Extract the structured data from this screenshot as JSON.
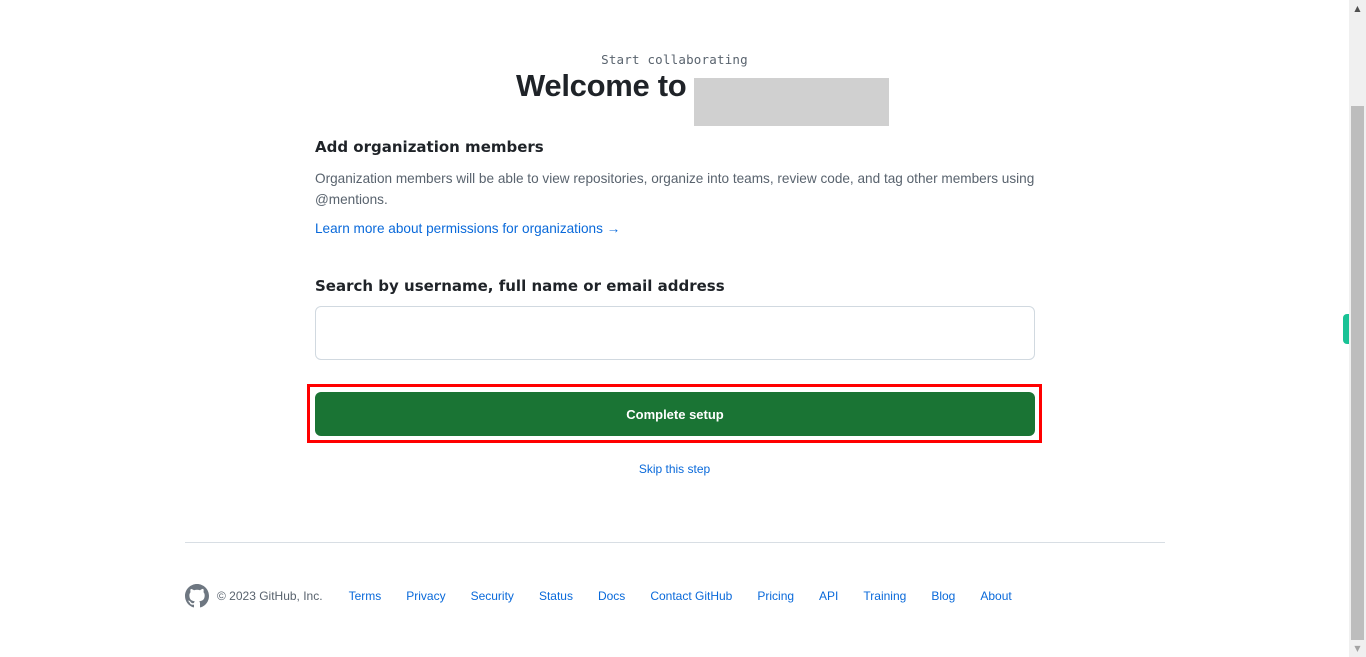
{
  "header": {
    "eyebrow": "Start collaborating",
    "title": "Welcome to"
  },
  "members": {
    "heading": "Add organization members",
    "description": "Organization members will be able to view repositories, organize into teams, review code, and tag other members using @mentions.",
    "learn_more_link": "Learn more about permissions for organizations →"
  },
  "search": {
    "label": "Search by username, full name or email address",
    "value": "",
    "placeholder": ""
  },
  "actions": {
    "complete_label": "Complete setup",
    "skip_label": "Skip this step"
  },
  "footer": {
    "logo_icon": "github-mark-icon",
    "copyright": "© 2023 GitHub, Inc.",
    "links": [
      "Terms",
      "Privacy",
      "Security",
      "Status",
      "Docs",
      "Contact GitHub",
      "Pricing",
      "API",
      "Training",
      "Blog",
      "About"
    ]
  },
  "colors": {
    "primary_button": "#1a7434",
    "link": "#0969da",
    "highlight_border": "#ff0000",
    "side_tab": "#19c295"
  },
  "scrollbar": {
    "up_icon": "scroll-up-arrow-icon",
    "down_icon": "scroll-down-arrow-icon"
  }
}
